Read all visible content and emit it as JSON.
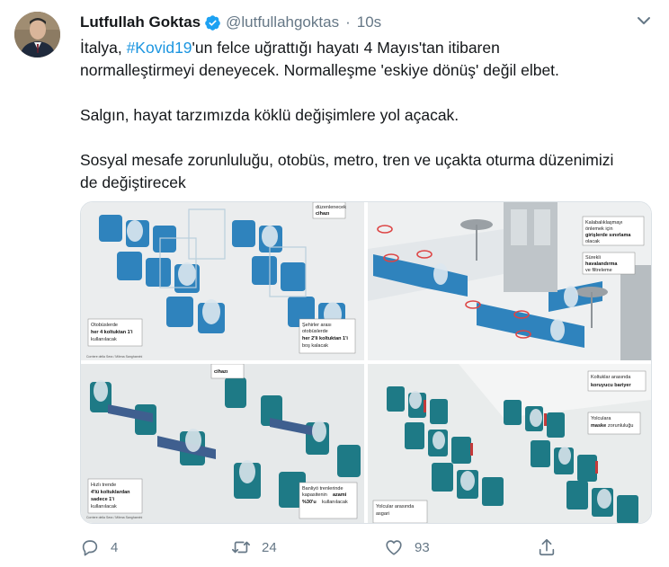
{
  "tweet": {
    "author_name": "Lutfullah Goktas",
    "handle": "@lutfullahgoktas",
    "separator": "·",
    "time": "10s",
    "verified_icon": "verified-badge-icon",
    "text": {
      "line1_prefix": "İtalya, ",
      "hashtag": "#Kovid19",
      "line1_suffix": "'un felce uğrattığı hayatı 4 Mayıs'tan itibaren",
      "line2": "normalleştirmeyi deneyecek. Normalleşme 'eskiye dönüş' değil elbet.",
      "para2": "Salgın, hayat tarzımızda köklü değişimlere yol açacak.",
      "para3_line1": "Sosyal mesafe zorunluluğu, otobüs, metro, tren ve uçakta oturma düzenimizi",
      "para3_line2": "de değiştirecek"
    }
  },
  "media": {
    "panels": [
      {
        "name": "bus",
        "labels": [
          {
            "l1": "düzenlenecek",
            "l2": "cihazı"
          },
          {
            "l1": "Otobüslerde",
            "b": "her 4 koltuktan 1'i",
            "l3": "kullanılacak"
          },
          {
            "l1": "Şehirler arası",
            "l2": "otobüslerde",
            "b": "her 2'li koltuktan 1'i",
            "l3": "boş kalacak"
          }
        ],
        "credit": "Corriere della Sera / Milena Sanghanrini"
      },
      {
        "name": "metro",
        "labels": [
          {
            "l1": "Kalabalıklaşmayı",
            "l2": "önlemek için",
            "b": "girişlerde sınırlama",
            "l3": "olacak"
          },
          {
            "l1": "Sürekli",
            "b": "havalandırma",
            "l3": "ve filtreleme"
          }
        ]
      },
      {
        "name": "train",
        "labels": [
          {
            "l1": "cihazı"
          },
          {
            "l1": "Hızlı trende",
            "b": "4'lü koltuklardan",
            "b2": "sadece 1'i",
            "l3": "kullanılacak"
          },
          {
            "l1": "Banliyö trenlerinde",
            "l2": "kapasitenin",
            "b": "azami",
            "b2": "%30'u",
            "l3": "kullanılacak"
          }
        ],
        "credit": "Corriere della Sera / Milena Sanghanrini"
      },
      {
        "name": "plane",
        "labels": [
          {
            "l1": "Koltuklar arasında",
            "b": "koruyucu bariyer"
          },
          {
            "l1": "Yolculara",
            "b": "maske",
            "l3": "zorunluluğu"
          },
          {
            "l1": "Yolcular arasında",
            "l2": "asgari"
          }
        ]
      }
    ]
  },
  "actions": {
    "reply": {
      "icon": "reply-icon",
      "count": "4"
    },
    "retweet": {
      "icon": "retweet-icon",
      "count": "24"
    },
    "like": {
      "icon": "like-icon",
      "count": "93"
    },
    "share": {
      "icon": "share-icon"
    }
  },
  "colors": {
    "link": "#1b95e0",
    "verified": "#1da1f2",
    "muted": "#657786",
    "seat_blue": "#2f83bd",
    "seat_teal": "#1e7a86"
  }
}
